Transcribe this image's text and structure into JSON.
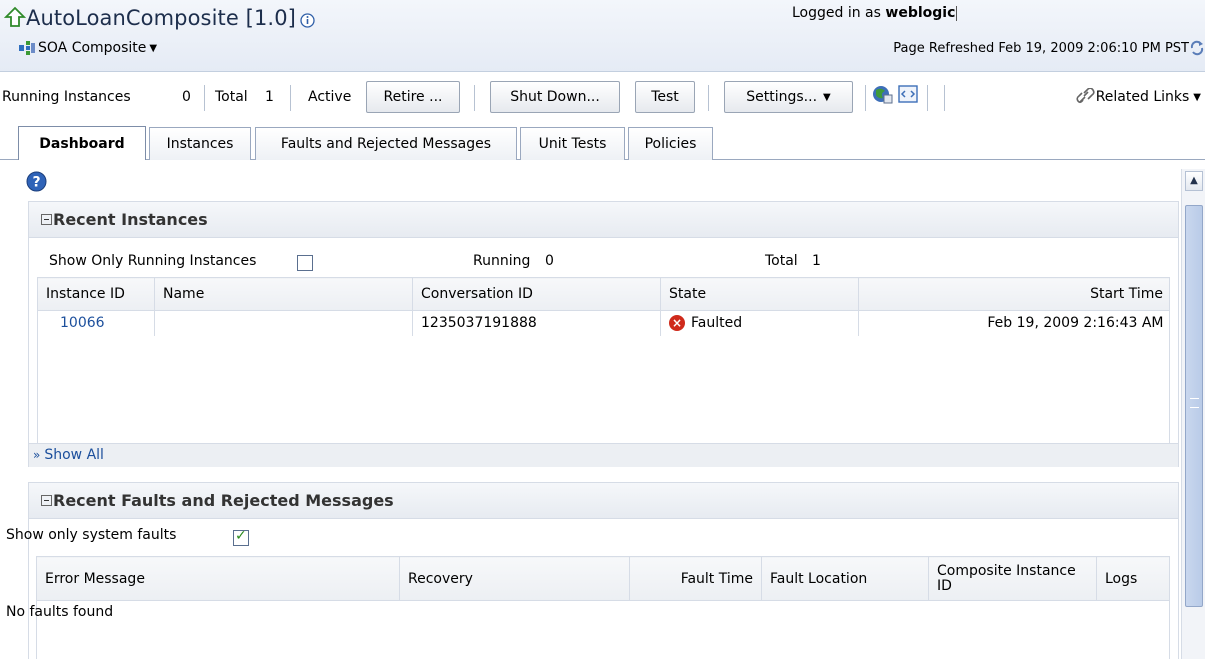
{
  "header": {
    "title": "AutoLoanComposite [1.0]",
    "composite_menu": "SOA Composite",
    "logged_in_prefix": "Logged in as",
    "user": "weblogic",
    "refreshed": "Page Refreshed Feb 19, 2009 2:06:10 PM PST"
  },
  "toolbar": {
    "running_label": "Running Instances",
    "running_value": "0",
    "total_label": "Total",
    "total_value": "1",
    "status": "Active",
    "retire_btn": "Retire ...",
    "shutdown_btn": "Shut Down...",
    "test_btn": "Test",
    "settings_btn": "Settings...",
    "related_links": "Related Links"
  },
  "tabs": [
    "Dashboard",
    "Instances",
    "Faults and Rejected Messages",
    "Unit Tests",
    "Policies"
  ],
  "recent_instances": {
    "title": "Recent Instances",
    "show_running_label": "Show Only Running Instances",
    "show_running_checked": false,
    "running_label": "Running",
    "running_value": "0",
    "total_label": "Total",
    "total_value": "1",
    "columns": [
      "Instance ID",
      "Name",
      "Conversation ID",
      "State",
      "Start Time"
    ],
    "rows": [
      {
        "instance_id": "10066",
        "name": "",
        "conversation_id": "1235037191888",
        "state": "Faulted",
        "start_time": "Feb 19, 2009 2:16:43 AM"
      }
    ],
    "show_all": "Show All"
  },
  "recent_faults": {
    "title": "Recent Faults and Rejected Messages",
    "system_faults_label": "Show only system faults",
    "system_faults_checked": true,
    "columns": [
      "Error Message",
      "Recovery",
      "Fault Time",
      "Fault Location",
      "Composite Instance ID",
      "Logs"
    ],
    "empty_text": "No faults found"
  },
  "colors": {
    "link": "#1c4f9c",
    "fault": "#cf2a1b",
    "header_bg": "#e5ebf5"
  }
}
